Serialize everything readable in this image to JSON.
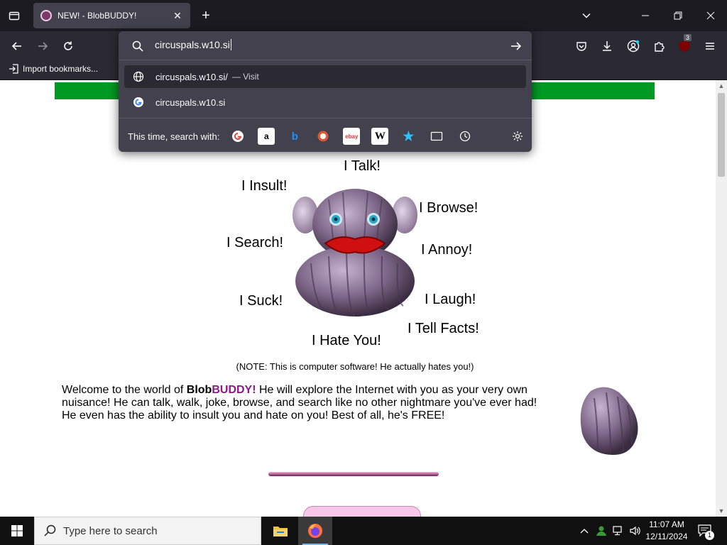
{
  "browser": {
    "tab": {
      "title": "NEW! - BlobBUDDY!"
    },
    "url_input": {
      "value": "circuspals.w10.si"
    },
    "suggestions": [
      {
        "text": "circuspals.w10.si/",
        "action": "— Visit"
      },
      {
        "text": "circuspals.w10.si",
        "action": ""
      }
    ],
    "oneoff_label": "This time, search with:",
    "oneoff_engines": [
      "google",
      "amazon",
      "bing",
      "duckduckgo",
      "ebay",
      "wikipedia",
      "bookmarks",
      "tabs",
      "history"
    ],
    "bookmarks_bar": {
      "import_label": "Import bookmarks..."
    },
    "extension_badge": "3"
  },
  "page": {
    "callouts": {
      "talk": "I Talk!",
      "insult": "I Insult!",
      "browse": "I Browse!",
      "search": "I Search!",
      "annoy": "I Annoy!",
      "suck": "I Suck!",
      "laugh": "I Laugh!",
      "facts": "I Tell Facts!",
      "hate": "I Hate You!"
    },
    "note": "(NOTE: This is computer software! He actually hates you!)",
    "welcome": {
      "line1_a": "Welcome to the world of ",
      "brand_a": "Blob",
      "brand_b": "BUDDY!",
      "line1_b": " He will explore the Internet with you as your very own nuisance!  He can talk, walk, joke, browse, and search like no other nightmare you've ever had! He even has the ability to insult you and hate on you! Best of all, he's FREE!"
    }
  },
  "taskbar": {
    "search_placeholder": "Type here to search",
    "time": "11:07 AM",
    "date": "12/11/2024",
    "notification_count": "1"
  }
}
